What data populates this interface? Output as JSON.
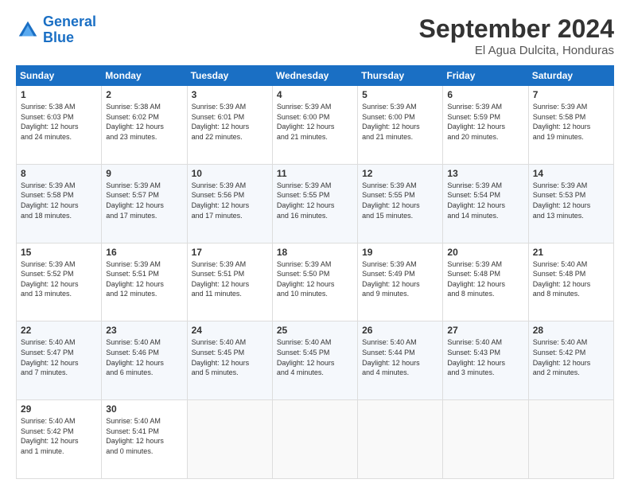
{
  "header": {
    "logo_general": "General",
    "logo_blue": "Blue",
    "month": "September 2024",
    "location": "El Agua Dulcita, Honduras"
  },
  "weekdays": [
    "Sunday",
    "Monday",
    "Tuesday",
    "Wednesday",
    "Thursday",
    "Friday",
    "Saturday"
  ],
  "weeks": [
    [
      {
        "day": "1",
        "info": "Sunrise: 5:38 AM\nSunset: 6:03 PM\nDaylight: 12 hours\nand 24 minutes."
      },
      {
        "day": "2",
        "info": "Sunrise: 5:38 AM\nSunset: 6:02 PM\nDaylight: 12 hours\nand 23 minutes."
      },
      {
        "day": "3",
        "info": "Sunrise: 5:39 AM\nSunset: 6:01 PM\nDaylight: 12 hours\nand 22 minutes."
      },
      {
        "day": "4",
        "info": "Sunrise: 5:39 AM\nSunset: 6:00 PM\nDaylight: 12 hours\nand 21 minutes."
      },
      {
        "day": "5",
        "info": "Sunrise: 5:39 AM\nSunset: 6:00 PM\nDaylight: 12 hours\nand 21 minutes."
      },
      {
        "day": "6",
        "info": "Sunrise: 5:39 AM\nSunset: 5:59 PM\nDaylight: 12 hours\nand 20 minutes."
      },
      {
        "day": "7",
        "info": "Sunrise: 5:39 AM\nSunset: 5:58 PM\nDaylight: 12 hours\nand 19 minutes."
      }
    ],
    [
      {
        "day": "8",
        "info": "Sunrise: 5:39 AM\nSunset: 5:58 PM\nDaylight: 12 hours\nand 18 minutes."
      },
      {
        "day": "9",
        "info": "Sunrise: 5:39 AM\nSunset: 5:57 PM\nDaylight: 12 hours\nand 17 minutes."
      },
      {
        "day": "10",
        "info": "Sunrise: 5:39 AM\nSunset: 5:56 PM\nDaylight: 12 hours\nand 17 minutes."
      },
      {
        "day": "11",
        "info": "Sunrise: 5:39 AM\nSunset: 5:55 PM\nDaylight: 12 hours\nand 16 minutes."
      },
      {
        "day": "12",
        "info": "Sunrise: 5:39 AM\nSunset: 5:55 PM\nDaylight: 12 hours\nand 15 minutes."
      },
      {
        "day": "13",
        "info": "Sunrise: 5:39 AM\nSunset: 5:54 PM\nDaylight: 12 hours\nand 14 minutes."
      },
      {
        "day": "14",
        "info": "Sunrise: 5:39 AM\nSunset: 5:53 PM\nDaylight: 12 hours\nand 13 minutes."
      }
    ],
    [
      {
        "day": "15",
        "info": "Sunrise: 5:39 AM\nSunset: 5:52 PM\nDaylight: 12 hours\nand 13 minutes."
      },
      {
        "day": "16",
        "info": "Sunrise: 5:39 AM\nSunset: 5:51 PM\nDaylight: 12 hours\nand 12 minutes."
      },
      {
        "day": "17",
        "info": "Sunrise: 5:39 AM\nSunset: 5:51 PM\nDaylight: 12 hours\nand 11 minutes."
      },
      {
        "day": "18",
        "info": "Sunrise: 5:39 AM\nSunset: 5:50 PM\nDaylight: 12 hours\nand 10 minutes."
      },
      {
        "day": "19",
        "info": "Sunrise: 5:39 AM\nSunset: 5:49 PM\nDaylight: 12 hours\nand 9 minutes."
      },
      {
        "day": "20",
        "info": "Sunrise: 5:39 AM\nSunset: 5:48 PM\nDaylight: 12 hours\nand 8 minutes."
      },
      {
        "day": "21",
        "info": "Sunrise: 5:40 AM\nSunset: 5:48 PM\nDaylight: 12 hours\nand 8 minutes."
      }
    ],
    [
      {
        "day": "22",
        "info": "Sunrise: 5:40 AM\nSunset: 5:47 PM\nDaylight: 12 hours\nand 7 minutes."
      },
      {
        "day": "23",
        "info": "Sunrise: 5:40 AM\nSunset: 5:46 PM\nDaylight: 12 hours\nand 6 minutes."
      },
      {
        "day": "24",
        "info": "Sunrise: 5:40 AM\nSunset: 5:45 PM\nDaylight: 12 hours\nand 5 minutes."
      },
      {
        "day": "25",
        "info": "Sunrise: 5:40 AM\nSunset: 5:45 PM\nDaylight: 12 hours\nand 4 minutes."
      },
      {
        "day": "26",
        "info": "Sunrise: 5:40 AM\nSunset: 5:44 PM\nDaylight: 12 hours\nand 4 minutes."
      },
      {
        "day": "27",
        "info": "Sunrise: 5:40 AM\nSunset: 5:43 PM\nDaylight: 12 hours\nand 3 minutes."
      },
      {
        "day": "28",
        "info": "Sunrise: 5:40 AM\nSunset: 5:42 PM\nDaylight: 12 hours\nand 2 minutes."
      }
    ],
    [
      {
        "day": "29",
        "info": "Sunrise: 5:40 AM\nSunset: 5:42 PM\nDaylight: 12 hours\nand 1 minute."
      },
      {
        "day": "30",
        "info": "Sunrise: 5:40 AM\nSunset: 5:41 PM\nDaylight: 12 hours\nand 0 minutes."
      },
      {
        "day": "",
        "info": ""
      },
      {
        "day": "",
        "info": ""
      },
      {
        "day": "",
        "info": ""
      },
      {
        "day": "",
        "info": ""
      },
      {
        "day": "",
        "info": ""
      }
    ]
  ]
}
